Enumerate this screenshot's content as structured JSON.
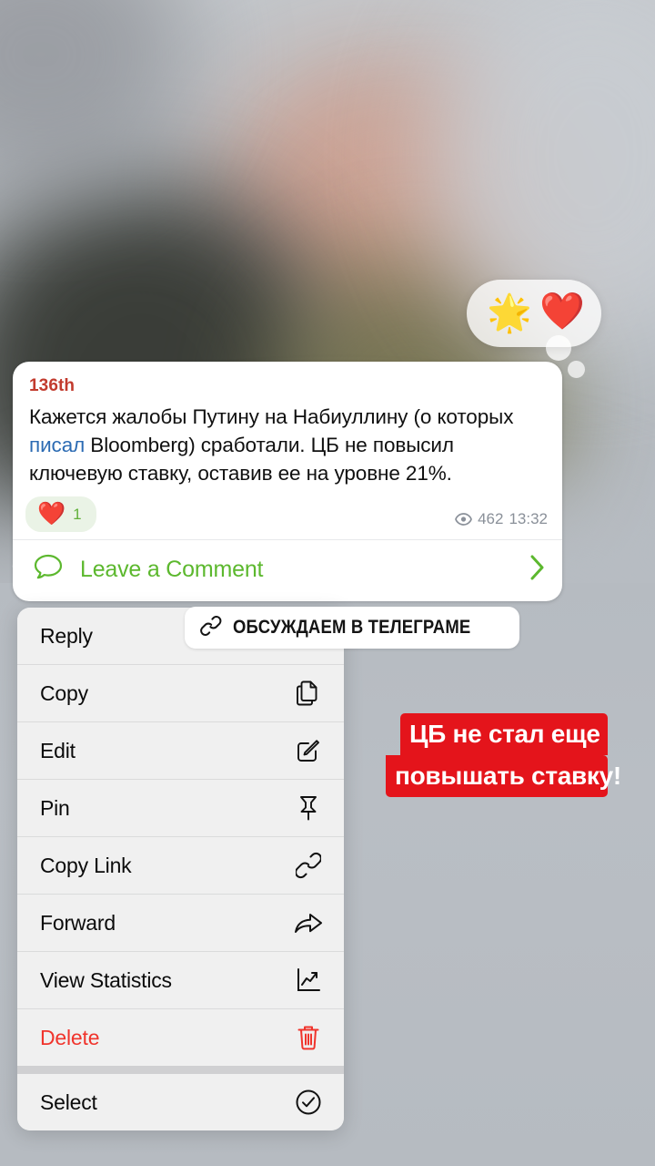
{
  "background": {
    "type": "blurred-photo",
    "base_color": "#b9bec4",
    "accent_colors": [
      "#c9a79a",
      "#3a3a32",
      "#6d6b4e",
      "#c6cace"
    ]
  },
  "reaction_bubble": {
    "name": "emoji-thought-bubble",
    "emojis": [
      "🌟",
      "❤️"
    ],
    "bubble_color": "#ffffff"
  },
  "message": {
    "channel_label": "136th",
    "channel_label_color": "#c23b2e",
    "text_parts": [
      {
        "text": "Кажется жалобы Путину на Набиуллину (о которых ",
        "type": "plain"
      },
      {
        "text": "писал",
        "type": "link",
        "color": "#2c6bb3"
      },
      {
        "text": " Bloomberg) сработали. ЦБ не повысил ключевую ставку, оставив ее на уровне 21%.",
        "type": "plain"
      }
    ],
    "full_text": "Кажется жалобы Путину на Набиуллину (о которых писал Bloomberg) сработали. ЦБ не повысил ключевую ставку, оставив ее на уровне 21%.",
    "reaction": {
      "emoji": "❤️",
      "count": "1",
      "pill_color": "#eaf3e6",
      "count_color": "#61b03a"
    },
    "views": "462",
    "time": "13:32",
    "views_icon": "eye-icon",
    "comment_button": {
      "label": "Leave a Comment",
      "icon": "comment-bubble-icon",
      "chevron": "chevron-right-icon",
      "color": "#5cb82e"
    }
  },
  "context_menu": {
    "items": [
      {
        "label": "Reply",
        "icon": "reply-arrow-icon",
        "icon_hidden": true,
        "danger": false
      },
      {
        "label": "Copy",
        "icon": "copy-documents-icon",
        "danger": false
      },
      {
        "label": "Edit",
        "icon": "pencil-square-icon",
        "danger": false
      },
      {
        "label": "Pin",
        "icon": "pushpin-icon",
        "danger": false
      },
      {
        "label": "Copy Link",
        "icon": "link-chain-icon",
        "danger": false
      },
      {
        "label": "Forward",
        "icon": "forward-arrow-icon",
        "danger": false
      },
      {
        "label": "View Statistics",
        "icon": "line-chart-icon",
        "danger": false
      },
      {
        "label": "Delete",
        "icon": "trash-can-icon",
        "danger": true
      },
      {
        "label": "Select",
        "icon": "check-circle-icon",
        "danger": false,
        "separated": true
      }
    ],
    "danger_color": "#f0342c"
  },
  "stickers": {
    "telegram_pill": {
      "label": "ОБСУЖДАЕМ В ТЕЛЕГРАМЕ",
      "icon": "link-chain-icon",
      "background": "#ffffff",
      "text_color": "#141414"
    },
    "red_banner": {
      "line1": "ЦБ не стал еще",
      "line2": "повышать ставку!",
      "background": "#e4141b",
      "text_color": "#ffffff"
    }
  }
}
